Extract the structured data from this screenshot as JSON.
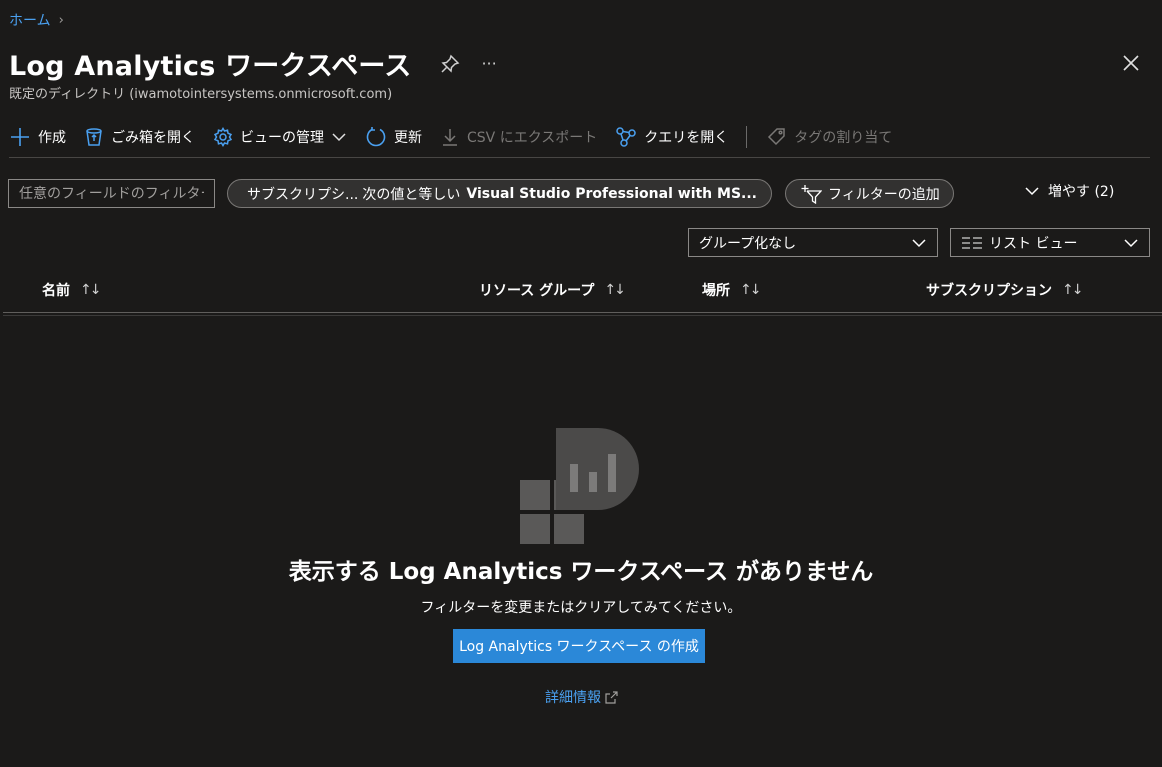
{
  "breadcrumb": {
    "home": "ホーム",
    "separator": "›"
  },
  "header": {
    "title": "Log Analytics ワークスペース",
    "subtitle": "既定のディレクトリ (iwamotointersystems.onmicrosoft.com)",
    "more": "···"
  },
  "toolbar": {
    "create": "作成",
    "recycle": "ごみ箱を開く",
    "manage_view": "ビューの管理",
    "refresh": "更新",
    "export_csv": "CSV にエクスポート",
    "open_query": "クエリを開く",
    "assign_tags": "タグの割り当て"
  },
  "filters": {
    "search_placeholder": "任意のフィールドのフィルター...",
    "subscription_pill": {
      "field": "サブスクリプシ...",
      "operator": "次の値と等しい",
      "value": "Visual Studio Professional with MS..."
    },
    "add_filter": "フィルターの追加",
    "expand": "増やす (2)"
  },
  "grouping": {
    "value": "グループ化なし"
  },
  "view_select": {
    "value": "リスト ビュー"
  },
  "columns": [
    {
      "label": "名前",
      "sort": "↑↓"
    },
    {
      "label": "リソース グループ",
      "sort": "↑↓"
    },
    {
      "label": "場所",
      "sort": "↑↓"
    },
    {
      "label": "サブスクリプション",
      "sort": "↑↓"
    }
  ],
  "empty_state": {
    "title": "表示する Log Analytics ワークスペース がありません",
    "description": "フィルターを変更またはクリアしてみてください。",
    "create_button": "Log Analytics ワークスペース の作成",
    "learn_more": "詳細情報"
  },
  "colors": {
    "accent": "#2b88d8",
    "link": "#4aa0f0",
    "background": "#1b1a19"
  }
}
